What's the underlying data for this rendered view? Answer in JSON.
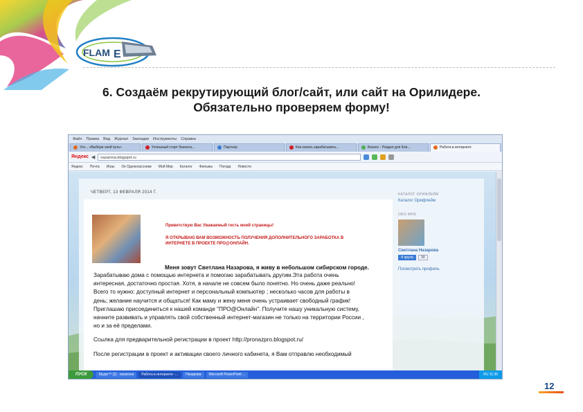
{
  "logo": {
    "brand_text": "FLAM"
  },
  "slide": {
    "title_line1": "6. Создаём рекрутирующий блог/сайт, или сайт на Орилидере.",
    "title_line2": "Обязательно проверяем форму!",
    "page_number": "12"
  },
  "browser": {
    "menu": [
      "Файл",
      "Правка",
      "Вид",
      "Журнал",
      "Закладки",
      "Инструменты",
      "Справка"
    ],
    "tabs": [
      {
        "label": "Усп... «Выбери свой путь»"
      },
      {
        "label": "Успешный старт бизнеса..."
      },
      {
        "label": "Партнер"
      },
      {
        "label": "Как начать зарабатывать..."
      },
      {
        "label": "Бизнес - Раздел для Кли..."
      },
      {
        "label": "Работа в интернете",
        "active": true
      }
    ],
    "search_brand": "Яндекс",
    "url": "nazarova.blogspot.ru",
    "bookmarks": [
      "Яндекс",
      "Почта",
      "Игры",
      "Ок Одноклассники",
      "Мой Мир",
      "Каталог",
      "Фильмы",
      "Погода",
      "Новости"
    ]
  },
  "blog": {
    "date_header": "ЧЕТВЕРГ, 13 ФЕВРАЛЯ 2014 Г.",
    "greeting": "Приветствую Вас Уважаемый гость моей страницы!",
    "offer_line1": "Я ОТКРЫВАЮ ВАМ ВОЗМОЖНОСТЬ ПОЛУЧЕНИЯ ДОПОЛНИТЕЛЬНОГО ЗАРАБОТКА В",
    "offer_line2": "ИНТЕРНЕТЕ В ПРОЕКТЕ ПРО@ОНЛАЙН.",
    "intro": "Меня зовут Светлана Назарова, я живу в небольшом сибирском  городе.",
    "body": [
      "  Зарабатываю дома с помощью интернета  и помогаю зарабатывать другим.Эта работа  очень",
      "интересная, достаточно простая. Хотя, в начале не совсем было  понятно. Но очень даже реально!",
      "Всего то нужно:  доступный интернет и персональный компьютер ; несколько часов для работы в",
      "день; желание научится и общаться! Как маму  и жену меня очень устраивает свободный график!",
      "Приглашаю присоединиться к нашей команде \"ПРО@Онлайн\". Получите нашу уникальную систему,",
      "начните развивать и управлять свой собственный интернет-магазин не только на территории России ,",
      "но и за её пределами.",
      "",
      "Ссылка для предварительной регистрации в проект http://pronazpro.blogspot.ru/",
      "",
      "После регистрации в проект и активации своего личного кабинета, я Вам отправлю  необходимый"
    ],
    "sidebar": {
      "catalog_head": "КАТАЛОГ ОРИФЛЕЙМ",
      "catalog_link": "Каталог Орифлейм",
      "about_head": "ОБО МНЕ",
      "name": "Светлана Назарова",
      "circles": "4 круга",
      "circles_count": "38",
      "profile_link": "Посмотреть профиль"
    }
  },
  "taskbar": {
    "start": "ПУСК",
    "tasks": [
      "Skype™ [1] - nazarova",
      "Работа в интернете -...",
      "Назарова",
      "Microsoft PowerPoint ..."
    ],
    "active_index": 1,
    "clock": "RU  11:36"
  }
}
